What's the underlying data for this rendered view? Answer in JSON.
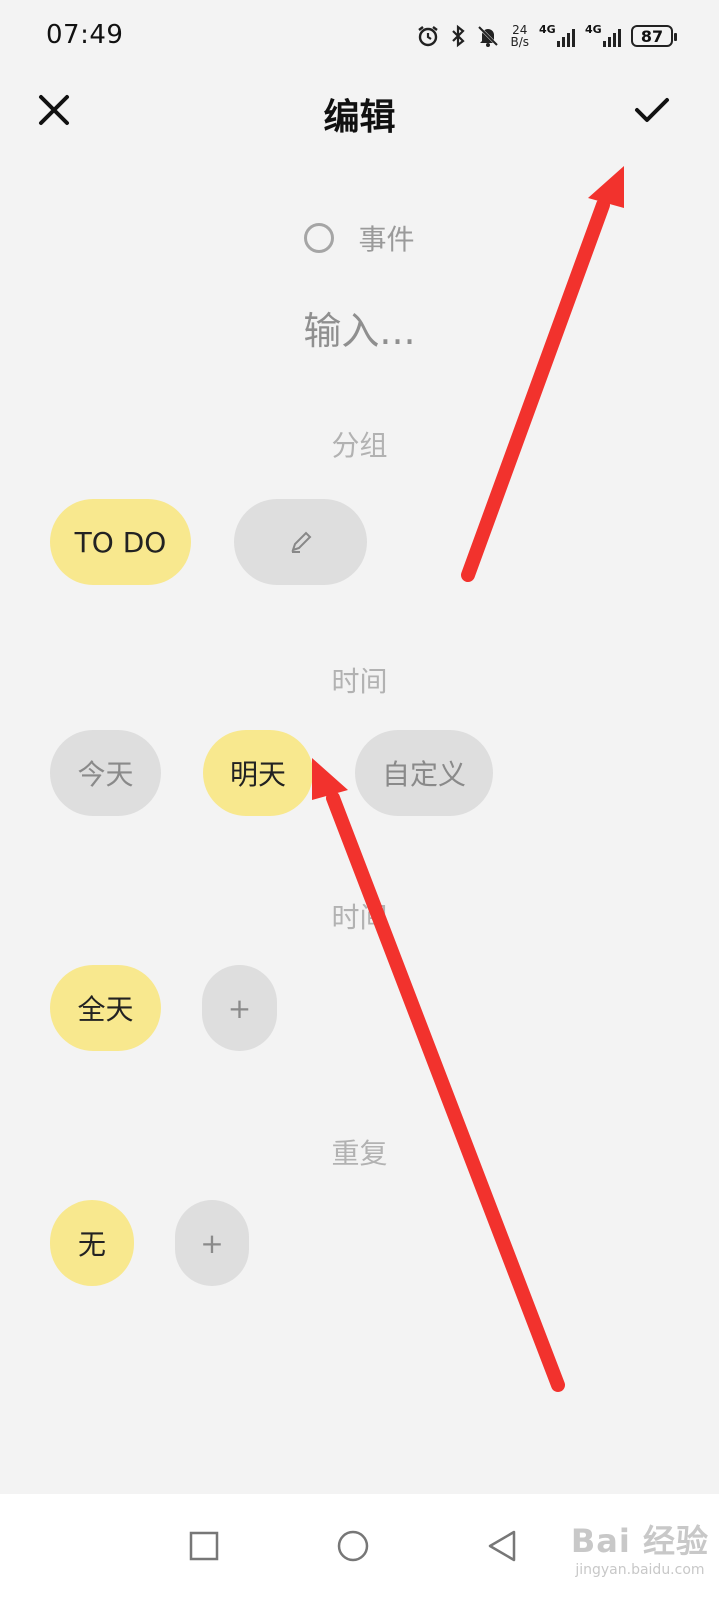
{
  "status_bar": {
    "time": "07:49",
    "net_speed_value": "24",
    "net_speed_unit": "B/s",
    "signal1_label": "4G",
    "signal2_label": "4G",
    "battery": "87",
    "icons": [
      "alarm-icon",
      "bluetooth-icon",
      "mute-icon"
    ]
  },
  "header": {
    "title": "编辑",
    "close_icon": "close-icon",
    "confirm_icon": "check-icon"
  },
  "event": {
    "label": "事件",
    "input_placeholder": "输入..."
  },
  "group": {
    "label": "分组",
    "options": [
      "TO DO"
    ],
    "edit_icon": "pencil-icon"
  },
  "date": {
    "label": "时间",
    "options": [
      "今天",
      "明天",
      "自定义"
    ],
    "selected": "明天"
  },
  "time": {
    "label": "时间",
    "options": [
      "全天",
      "+"
    ],
    "selected": "全天"
  },
  "repeat": {
    "label": "重复",
    "options": [
      "无",
      "+"
    ],
    "selected": "无"
  },
  "watermark": {
    "main": "Bai 经验",
    "sub": "jingyan.baidu.com"
  },
  "colors": {
    "selected_pill": "#f8e88e",
    "unselected_pill": "#dedede",
    "annotation_arrow": "#f2322d"
  }
}
